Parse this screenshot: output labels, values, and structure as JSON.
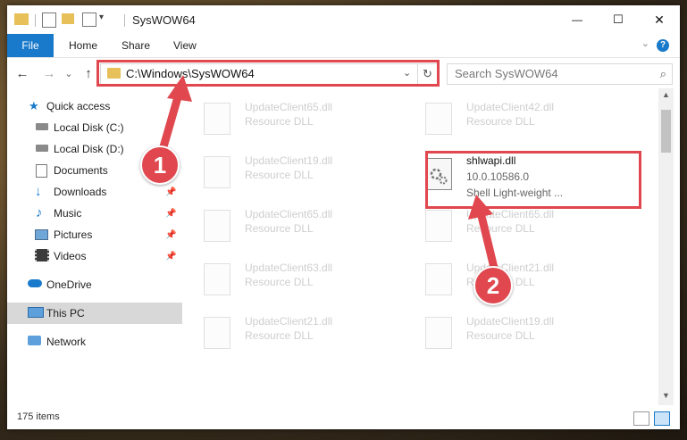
{
  "window": {
    "title": "SysWOW64",
    "controls": {
      "minimize": "—",
      "maximize": "☐",
      "close": "✕"
    }
  },
  "ribbon": {
    "tabs": [
      {
        "label": "File"
      },
      {
        "label": "Home"
      },
      {
        "label": "Share"
      },
      {
        "label": "View"
      }
    ],
    "help": "?"
  },
  "navigation": {
    "back": "←",
    "forward": "→",
    "recent": "⌄",
    "up": "↑",
    "address_path": "C:\\Windows\\SysWOW64",
    "search_placeholder": "Search SysWOW64"
  },
  "sidebar": {
    "items": [
      {
        "label": "Quick access",
        "icon": "star-icon",
        "pinned": false
      },
      {
        "label": "Local Disk (C:)",
        "icon": "drive-icon",
        "pinned": false
      },
      {
        "label": "Local Disk (D:)",
        "icon": "drive-icon",
        "pinned": false
      },
      {
        "label": "Documents",
        "icon": "documents-icon",
        "pinned": true
      },
      {
        "label": "Downloads",
        "icon": "download-icon",
        "pinned": true
      },
      {
        "label": "Music",
        "icon": "music-icon",
        "pinned": true
      },
      {
        "label": "Pictures",
        "icon": "pictures-icon",
        "pinned": true
      },
      {
        "label": "Videos",
        "icon": "videos-icon",
        "pinned": true
      },
      {
        "label": "OneDrive",
        "icon": "cloud-icon",
        "pinned": false
      },
      {
        "label": "This PC",
        "icon": "computer-icon",
        "pinned": false,
        "selected": true
      },
      {
        "label": "Network",
        "icon": "network-icon",
        "pinned": false
      }
    ]
  },
  "files": {
    "left": [
      {
        "name": "UpdateClient65.dll",
        "type": "Resource DLL"
      },
      {
        "name": "UpdateClient19.dll",
        "type": "Resource DLL"
      },
      {
        "name": "UpdateClient65.dll",
        "type": "Resource DLL"
      },
      {
        "name": "UpdateClient63.dll",
        "type": "Resource DLL"
      },
      {
        "name": "UpdateClient21.dll",
        "type": "Resource DLL"
      }
    ],
    "right": [
      {
        "name": "UpdateClient42.dll",
        "type": "Resource DLL"
      },
      {
        "name": "shlwapi.dll",
        "version": "10.0.10586.0",
        "description": "Shell Light-weight ..."
      },
      {
        "name": "UpdateClient65.dll",
        "type": "Resource DLL"
      },
      {
        "name": "UpdateClient21.dll",
        "type": "Resource DLL"
      },
      {
        "name": "UpdateClient19.dll",
        "type": "Resource DLL"
      }
    ]
  },
  "status": {
    "item_count": "175 items"
  },
  "annotations": {
    "step1": "1",
    "step2": "2",
    "color": "#e0474e"
  }
}
